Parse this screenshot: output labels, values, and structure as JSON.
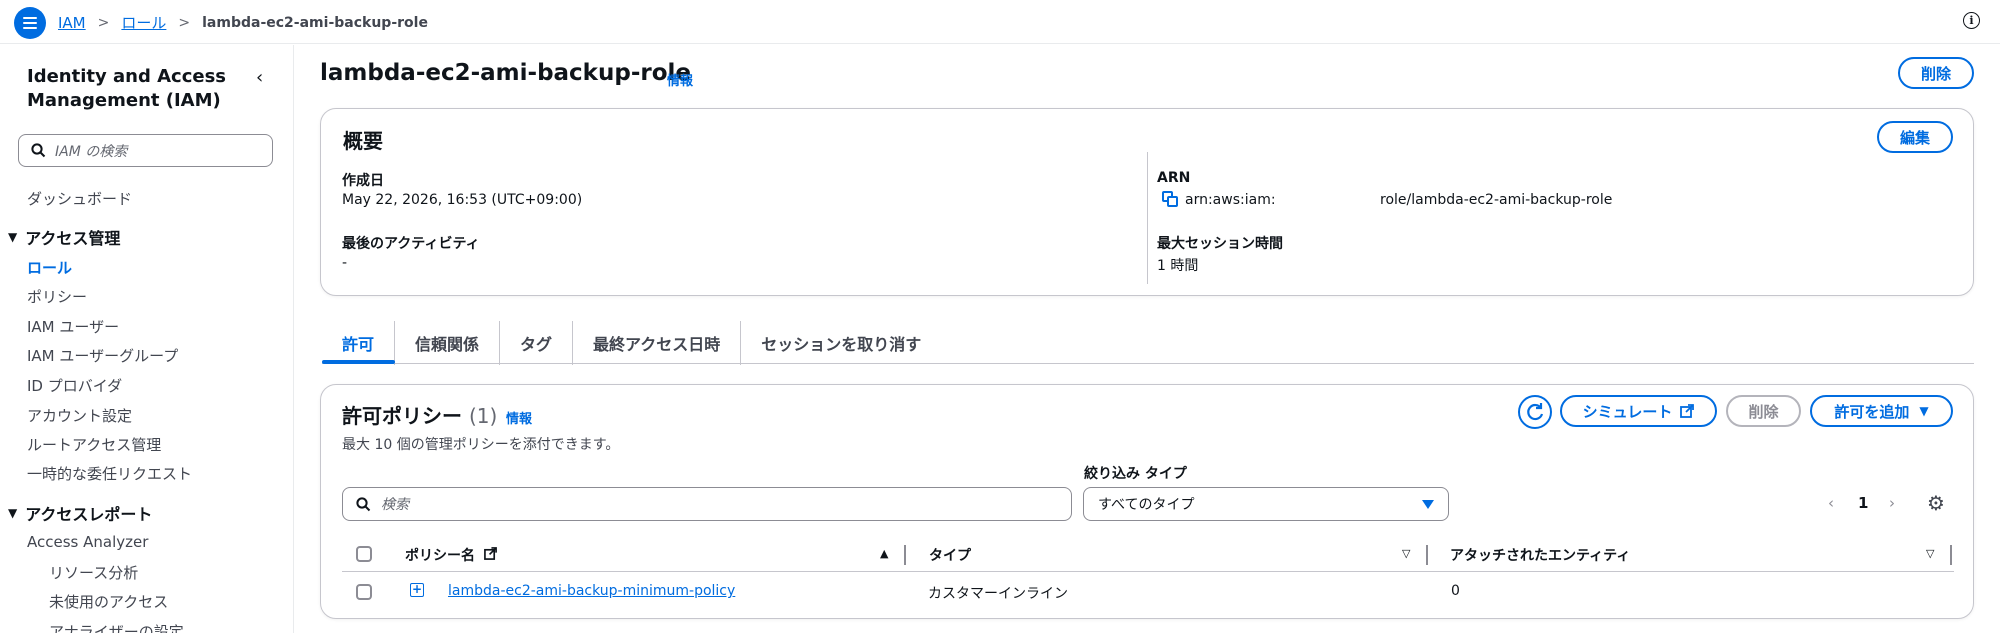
{
  "topbar": {
    "breadcrumb": [
      "IAM",
      "ロール",
      "lambda-ec2-ami-backup-role"
    ]
  },
  "sidebar": {
    "title": "Identity and Access Management (IAM)",
    "search_placeholder": "IAM の検索",
    "dashboard": "ダッシュボード",
    "section_access": "アクセス管理",
    "items": [
      "ロール",
      "ポリシー",
      "IAM ユーザー",
      "IAM ユーザーグループ",
      "ID プロバイダ",
      "アカウント設定",
      "ルートアクセス管理",
      "一時的な委任リクエスト"
    ],
    "section_report": "アクセスレポート",
    "report_items": [
      "Access Analyzer"
    ],
    "report_sub": [
      "リソース分析",
      "未使用のアクセス",
      "アナライザーの設定"
    ]
  },
  "page": {
    "title": "lambda-ec2-ami-backup-role",
    "info": "情報",
    "delete_label": "削除"
  },
  "summary": {
    "heading": "概要",
    "edit_label": "編集",
    "created_label": "作成日",
    "created_value": "May 22, 2026, 16:53 (UTC+09:00)",
    "last_activity_label": "最後のアクティビティ",
    "last_activity_value": "-",
    "arn_label": "ARN",
    "arn_prefix": "arn:aws:iam:",
    "arn_suffix": "role/lambda-ec2-ami-backup-role",
    "max_session_label": "最大セッション時間",
    "max_session_value": "1 時間"
  },
  "tabs": [
    "許可",
    "信頼関係",
    "タグ",
    "最終アクセス日時",
    "セッションを取り消す"
  ],
  "policies": {
    "title": "許可ポリシー",
    "count": "(1)",
    "info": "情報",
    "description": "最大 10 個の管理ポリシーを添付できます。",
    "simulate_label": "シミュレート",
    "delete_label": "削除",
    "add_label": "許可を追加",
    "filter_label": "絞り込み タイプ",
    "search_placeholder": "検索",
    "filter_value": "すべてのタイプ",
    "page_number": "1",
    "columns": [
      "ポリシー名",
      "タイプ",
      "アタッチされたエンティティ"
    ],
    "rows": [
      {
        "name": "lambda-ec2-ami-backup-minimum-policy",
        "type": "カスタマーインライン",
        "entities": "0"
      }
    ]
  },
  "colors": {
    "accent": "#006ce0",
    "text": "#0f141a",
    "border": "#c6c6cd"
  }
}
